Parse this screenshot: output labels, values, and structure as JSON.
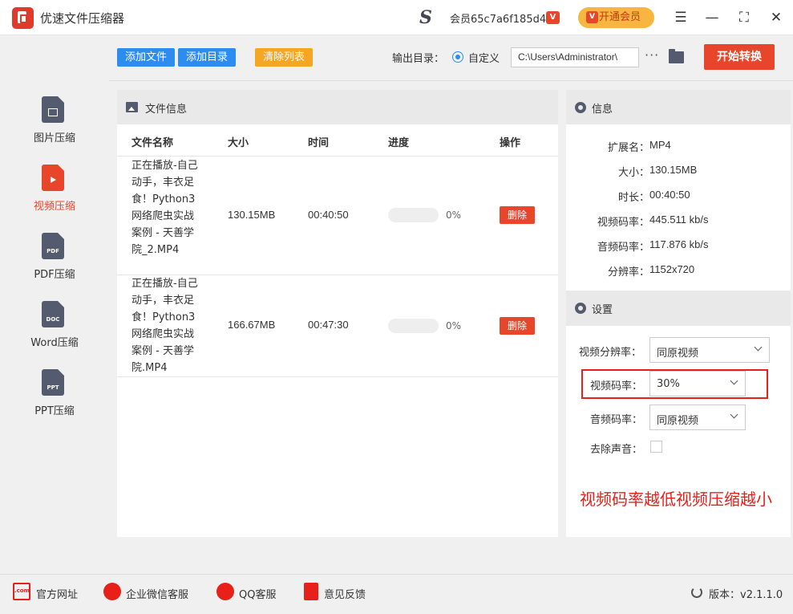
{
  "app": {
    "title": "优速文件压缩器",
    "member_id": "会员65c7a6f185d4",
    "vip_badge": "V",
    "open_vip": "开通会员",
    "menu_glyph": "☰",
    "min_glyph": "—",
    "max_glyph": "⛶",
    "close_glyph": "✕"
  },
  "sidebar": {
    "items": [
      {
        "label": "图片压缩",
        "icon": "image-file-icon",
        "badge": ""
      },
      {
        "label": "视频压缩",
        "icon": "video-file-icon",
        "badge": "",
        "active": true
      },
      {
        "label": "PDF压缩",
        "icon": "pdf-file-icon",
        "badge": "PDF"
      },
      {
        "label": "Word压缩",
        "icon": "word-file-icon",
        "badge": "DOC"
      },
      {
        "label": "PPT压缩",
        "icon": "ppt-file-icon",
        "badge": "PPT"
      }
    ]
  },
  "toolbar": {
    "add_file": "添加文件",
    "add_dir": "添加目录",
    "clear_list": "清除列表",
    "output_label": "输出目录：",
    "custom_label": "自定义",
    "output_path": "C:\\Users\\Administrator\\",
    "more": "···",
    "start": "开始转换"
  },
  "file_panel": {
    "title": "文件信息",
    "columns": [
      "文件名称",
      "大小",
      "时间",
      "进度",
      "操作"
    ],
    "rows": [
      {
        "name": "正在播放-自己动手，丰衣足食！Python3网络爬虫实战案例 - 天善学院_2.MP4",
        "size": "130.15MB",
        "time": "00:40:50",
        "progress": 0,
        "progress_text": "0%",
        "action": "删除"
      },
      {
        "name": "正在播放-自己动手，丰衣足食！Python3网络爬虫实战案例 - 天善学院.MP4",
        "size": "166.67MB",
        "time": "00:47:30",
        "progress": 0,
        "progress_text": "0%",
        "action": "删除"
      }
    ]
  },
  "info_panel": {
    "title": "信息",
    "rows": [
      {
        "key": "扩展名：",
        "value": "MP4"
      },
      {
        "key": "大小：",
        "value": "130.15MB"
      },
      {
        "key": "时长：",
        "value": "00:40:50"
      },
      {
        "key": "视频码率：",
        "value": "445.511 kb/s"
      },
      {
        "key": "音频码率：",
        "value": "117.876 kb/s"
      },
      {
        "key": "分辨率：",
        "value": "1152x720"
      }
    ]
  },
  "settings": {
    "title": "设置",
    "resolution_label": "视频分辨率：",
    "resolution_value": "同原视频",
    "video_bitrate_label": "视频码率：",
    "video_bitrate_value": "30%",
    "audio_bitrate_label": "音频码率：",
    "audio_bitrate_value": "同原视频",
    "remove_audio_label": "去除声音：",
    "remove_audio_checked": false,
    "note": "视频码率越低视频压缩越小"
  },
  "footer": {
    "website": "官方网址",
    "website_icon_text": ".com",
    "wechat": "企业微信客服",
    "qq": "QQ客服",
    "feedback": "意见反馈",
    "version": "版本：v2.1.1.0"
  },
  "colors": {
    "accent": "#e8462a",
    "blue": "#2d8cf0",
    "orange": "#f5a623",
    "highlight": "#e8201a"
  }
}
